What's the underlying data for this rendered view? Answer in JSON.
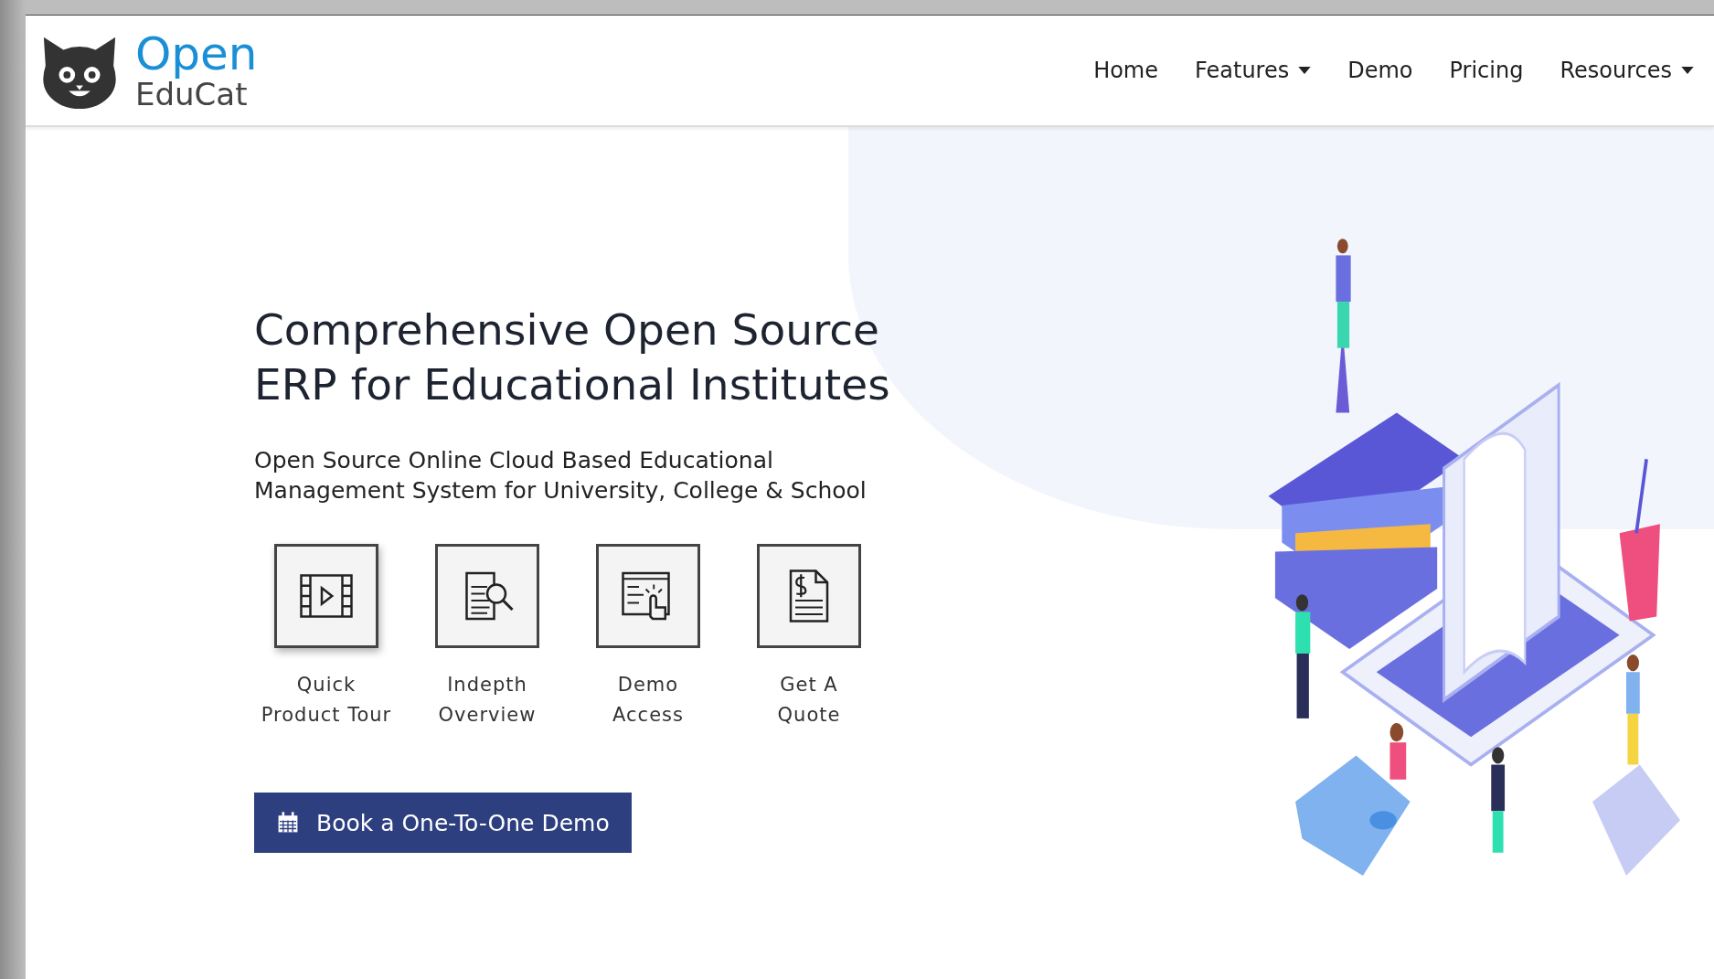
{
  "logo": {
    "line_1": "Open",
    "line_2": "EduCat"
  },
  "nav": [
    {
      "label": "Home",
      "dropdown": false
    },
    {
      "label": "Features",
      "dropdown": true
    },
    {
      "label": "Demo",
      "dropdown": false
    },
    {
      "label": "Pricing",
      "dropdown": false
    },
    {
      "label": "Resources",
      "dropdown": true
    }
  ],
  "hero": {
    "title": "Comprehensive Open Source ERP for Educational Institutes",
    "subtitle": "Open Source Online Cloud Based Educational Management System for University, College & School"
  },
  "features": [
    {
      "kind": "video",
      "label": "Quick\nProduct Tour"
    },
    {
      "kind": "document",
      "label": "Indepth\nOverview"
    },
    {
      "kind": "click",
      "label": "Demo\nAccess"
    },
    {
      "kind": "invoice",
      "label": "Get A\nQuote"
    }
  ],
  "cta": {
    "label": "Book a One-To-One Demo"
  }
}
